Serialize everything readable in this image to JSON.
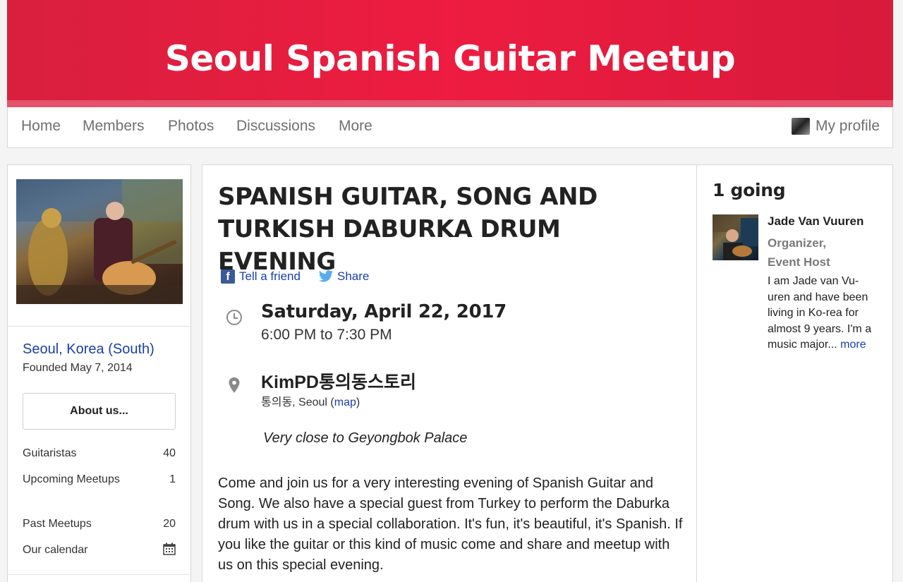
{
  "banner": {
    "title": "Seoul Spanish Guitar Meetup"
  },
  "nav": {
    "items": [
      "Home",
      "Members",
      "Photos",
      "Discussions",
      "More"
    ],
    "profile_label": "My profile"
  },
  "sidebar": {
    "location": "Seoul, Korea (South)",
    "founded": "Founded May 7, 2014",
    "about_label": "About us...",
    "stats": [
      {
        "label": "Guitaristas",
        "value": "40"
      },
      {
        "label": "Upcoming Meetups",
        "value": "1"
      },
      {
        "label": "Past Meetups",
        "value": "20"
      },
      {
        "label": "Our calendar",
        "icon": "calendar-icon"
      }
    ]
  },
  "event": {
    "title": "SPANISH GUITAR, SONG AND TURKISH DABURKA DRUM EVENING",
    "share": {
      "tell_friend": "Tell a friend",
      "share": "Share"
    },
    "date": "Saturday, April 22, 2017",
    "time": "6:00 PM to 7:30 PM",
    "venue_name": "KimPD통의동스토리",
    "venue_address_prefix": "통의동, Seoul (",
    "map_label": "map",
    "venue_address_suffix": ")",
    "venue_note": "Very close to Geyongbok Palace",
    "description": "Come and join us for a very interesting evening of Spanish Guitar and Song. We also have a special guest from Turkey to perform the Daburka drum with us in a special collaboration. It's fun, it's beautiful, it's Spanish. If you like the guitar or this kind of music come and share and meetup with us on this special evening."
  },
  "attendees": {
    "title": "1 going",
    "list": [
      {
        "name": "Jade Van Vuuren",
        "role_line1": "Organizer,",
        "role_line2": "Event Host",
        "bio": "I am Jade van Vu-uren and have been living in Ko-rea for almost 9 years. I'm a music major...",
        "more_label": "more"
      }
    ]
  },
  "colors": {
    "brand": "#ed1c40",
    "link": "#1a3fa8"
  }
}
